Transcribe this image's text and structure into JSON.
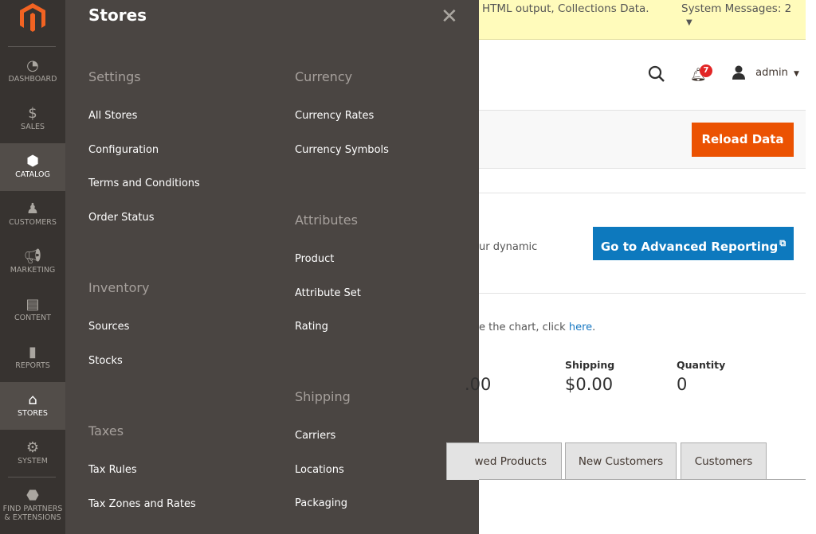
{
  "sidebar": {
    "items": [
      {
        "label": "DASHBOARD",
        "icon": "dashboard-icon"
      },
      {
        "label": "SALES",
        "icon": "dollar-icon"
      },
      {
        "label": "CATALOG",
        "icon": "box-icon"
      },
      {
        "label": "CUSTOMERS",
        "icon": "person-icon"
      },
      {
        "label": "MARKETING",
        "icon": "megaphone-icon"
      },
      {
        "label": "CONTENT",
        "icon": "layout-icon"
      },
      {
        "label": "REPORTS",
        "icon": "bar-chart-icon"
      },
      {
        "label": "STORES",
        "icon": "storefront-icon"
      },
      {
        "label": "SYSTEM",
        "icon": "gear-icon"
      },
      {
        "label": "FIND PARTNERS & EXTENSIONS",
        "icon": "lego-brick-icon"
      }
    ]
  },
  "flyout": {
    "title": "Stores",
    "settings": {
      "heading": "Settings",
      "items": [
        "All Stores",
        "Configuration",
        "Terms and Conditions",
        "Order Status"
      ]
    },
    "inventory": {
      "heading": "Inventory",
      "items": [
        "Sources",
        "Stocks"
      ]
    },
    "taxes": {
      "heading": "Taxes",
      "items": [
        "Tax Rules",
        "Tax Zones and Rates"
      ]
    },
    "currency": {
      "heading": "Currency",
      "items": [
        "Currency Rates",
        "Currency Symbols"
      ]
    },
    "attributes": {
      "heading": "Attributes",
      "items": [
        "Product",
        "Attribute Set",
        "Rating"
      ]
    },
    "shipping": {
      "heading": "Shipping",
      "items": [
        "Carriers",
        "Locations",
        "Packaging"
      ]
    }
  },
  "messages": {
    "text": "HTML output, Collections Data.",
    "system": "System Messages: 2"
  },
  "header": {
    "notifications": "7",
    "user": "admin"
  },
  "toolbar": {
    "reload": "Reload Data"
  },
  "reporting": {
    "text": "ur dynamic",
    "button": "Go to Advanced Reporting"
  },
  "chart_note": {
    "text": "e the chart, click ",
    "link": "here",
    "end": "."
  },
  "stats": [
    {
      "label": "",
      "value": ".00"
    },
    {
      "label": "Shipping",
      "value": "$0.00"
    },
    {
      "label": "Quantity",
      "value": "0"
    }
  ],
  "tabs": [
    "wed Products",
    "New Customers",
    "Customers"
  ]
}
